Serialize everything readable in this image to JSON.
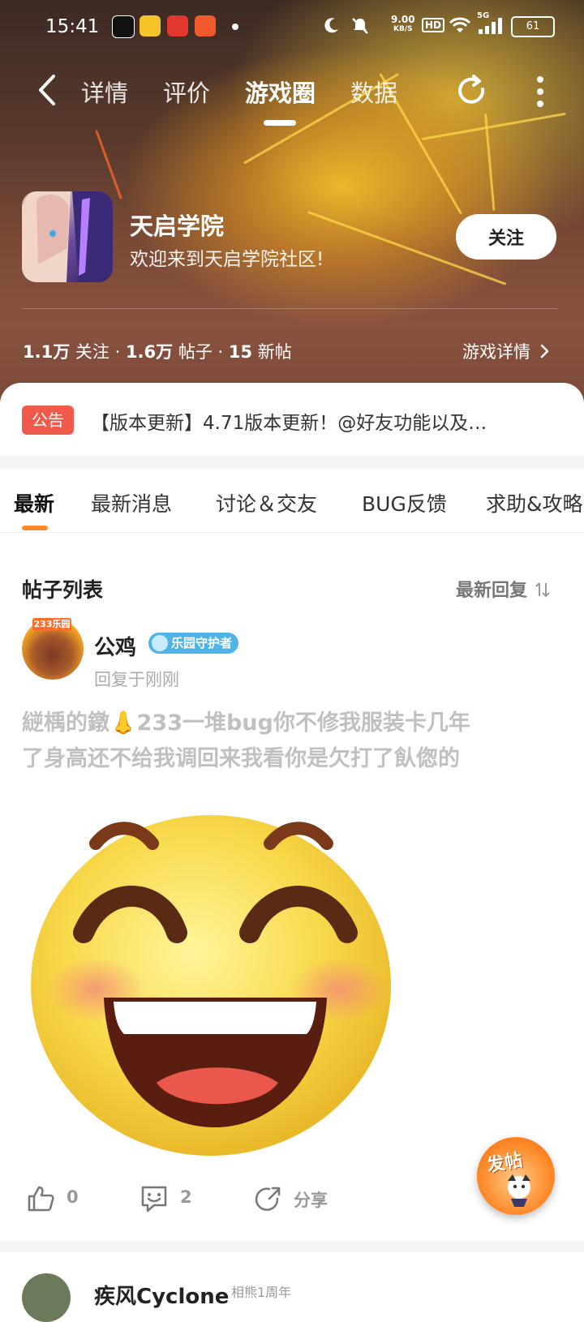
{
  "status_bar": {
    "time": "15:41",
    "speed_value": "9.00",
    "speed_unit": "KB/S",
    "hd": "HD",
    "network": "5G",
    "battery": "61"
  },
  "nav": {
    "tabs": [
      {
        "label": "详情"
      },
      {
        "label": "评价"
      },
      {
        "label": "游戏圈"
      },
      {
        "label": "数据"
      }
    ],
    "active_tab": "游戏圈"
  },
  "game": {
    "title": "天启学院",
    "subtitle": "欢迎来到天启学院社区!",
    "follow_label": "关注",
    "stats": {
      "followers_value": "1.1万",
      "followers_label": "关注",
      "posts_value": "1.6万",
      "posts_label": "帖子",
      "new_value": "15",
      "new_label": "新帖"
    },
    "detail_link": "游戏详情"
  },
  "notice": {
    "tag": "公告",
    "text": "【版本更新】4.71版本更新！@好友功能以及…"
  },
  "categories": [
    {
      "label": "最新"
    },
    {
      "label": "最新消息"
    },
    {
      "label": "讨论＆交友"
    },
    {
      "label": "BUG反馈"
    },
    {
      "label": "求助&攻略"
    }
  ],
  "post_list": {
    "heading": "帖子列表",
    "sort_label": "最新回复"
  },
  "post": {
    "avatar_badge": "233乐园",
    "author": "公鸡",
    "badge": "乐园守护者",
    "reply_time": "回复于刚刚",
    "content_line1": "縌楀的鐓👃233一堆bug你不修我服装卡几年",
    "content_line2": "了身高还不给我调回来我看你是欠打了飤偬的",
    "likes": "0",
    "comments": "2",
    "share_label": "分享"
  },
  "next_post": {
    "author": "疾风Cyclone",
    "badge": "相熊1周年"
  },
  "fab": {
    "label": "发帖"
  },
  "colors": {
    "accent_orange": "#ff8a2a",
    "notice_red": "#f15a4a",
    "badge_blue": "#4fb3e8"
  }
}
